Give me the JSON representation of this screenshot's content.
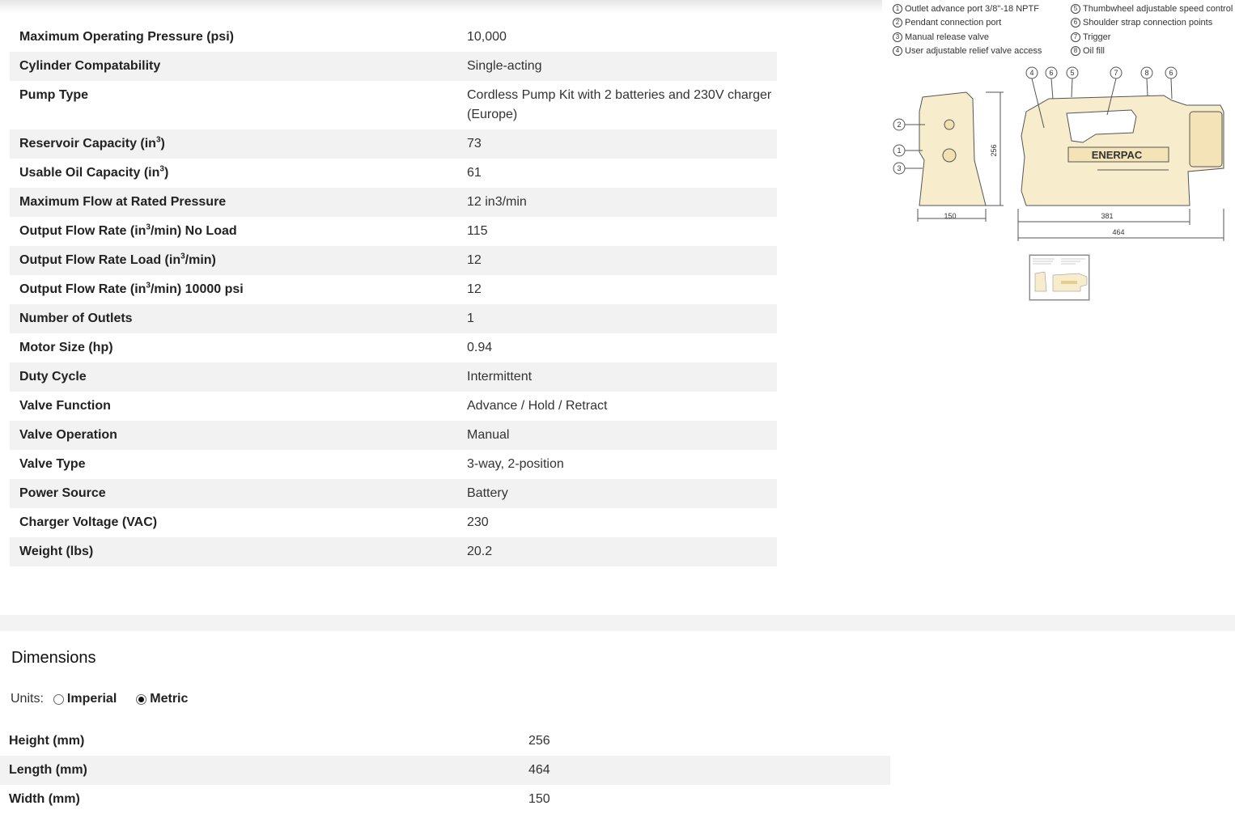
{
  "specs": [
    {
      "label": "Maximum Operating Pressure (psi)",
      "value": "10,000"
    },
    {
      "label": "Cylinder Compatability",
      "value": "Single-acting"
    },
    {
      "label": "Pump Type",
      "value": "Cordless Pump Kit with 2 batteries and 230V charger (Europe)"
    },
    {
      "label_pre": "Reservoir Capacity (in",
      "label_sup": "3",
      "label_post": ")",
      "value": "73"
    },
    {
      "label_pre": "Usable Oil Capacity (in",
      "label_sup": "3",
      "label_post": ")",
      "value": "61"
    },
    {
      "label": "Maximum Flow at Rated Pressure",
      "value": "12 in3/min"
    },
    {
      "label_pre": "Output Flow Rate (in",
      "label_sup": "3",
      "label_post": "/min) No Load",
      "value": "115"
    },
    {
      "label_pre": "Output Flow Rate Load (in",
      "label_sup": "3",
      "label_post": "/min)",
      "value": "12"
    },
    {
      "label_pre": "Output Flow Rate (in",
      "label_sup": "3",
      "label_post": "/min) 10000 psi",
      "value": "12"
    },
    {
      "label": "Number of Outlets",
      "value": "1"
    },
    {
      "label": "Motor Size (hp)",
      "value": "0.94"
    },
    {
      "label": "Duty Cycle",
      "value": "Intermittent"
    },
    {
      "label": "Valve Function",
      "value": "Advance / Hold / Retract"
    },
    {
      "label": "Valve Operation",
      "value": "Manual"
    },
    {
      "label": "Valve Type",
      "value": "3-way, 2-position"
    },
    {
      "label": "Power Source",
      "value": "Battery"
    },
    {
      "label": "Charger Voltage (VAC)",
      "value": "230"
    },
    {
      "label": "Weight (lbs)",
      "value": "20.2"
    }
  ],
  "legend": {
    "left": [
      {
        "n": "1",
        "text": "Outlet advance port 3/8\"-18 NPTF"
      },
      {
        "n": "2",
        "text": "Pendant connection port"
      },
      {
        "n": "3",
        "text": "Manual release valve"
      },
      {
        "n": "4",
        "text": "User adjustable relief valve access"
      }
    ],
    "right": [
      {
        "n": "5",
        "text": "Thumbwheel adjustable speed control"
      },
      {
        "n": "6",
        "text": "Shoulder strap connection points"
      },
      {
        "n": "7",
        "text": "Trigger"
      },
      {
        "n": "8",
        "text": "Oil fill"
      }
    ]
  },
  "drawing": {
    "brand": "ENERPAC",
    "dim_height": "256",
    "dim_width": "150",
    "dim_body": "381",
    "dim_length": "464",
    "callouts": [
      "1",
      "2",
      "3",
      "4",
      "5",
      "6",
      "7",
      "8"
    ],
    "body_color": "#f7eccb",
    "line_color": "#555555"
  },
  "dimensions": {
    "title": "Dimensions",
    "units_label": "Units:",
    "imperial": "Imperial",
    "metric": "Metric",
    "selected": "Metric",
    "rows": [
      {
        "label": "Height (mm)",
        "value": "256"
      },
      {
        "label": "Length (mm)",
        "value": "464"
      },
      {
        "label": "Width (mm)",
        "value": "150"
      }
    ]
  }
}
